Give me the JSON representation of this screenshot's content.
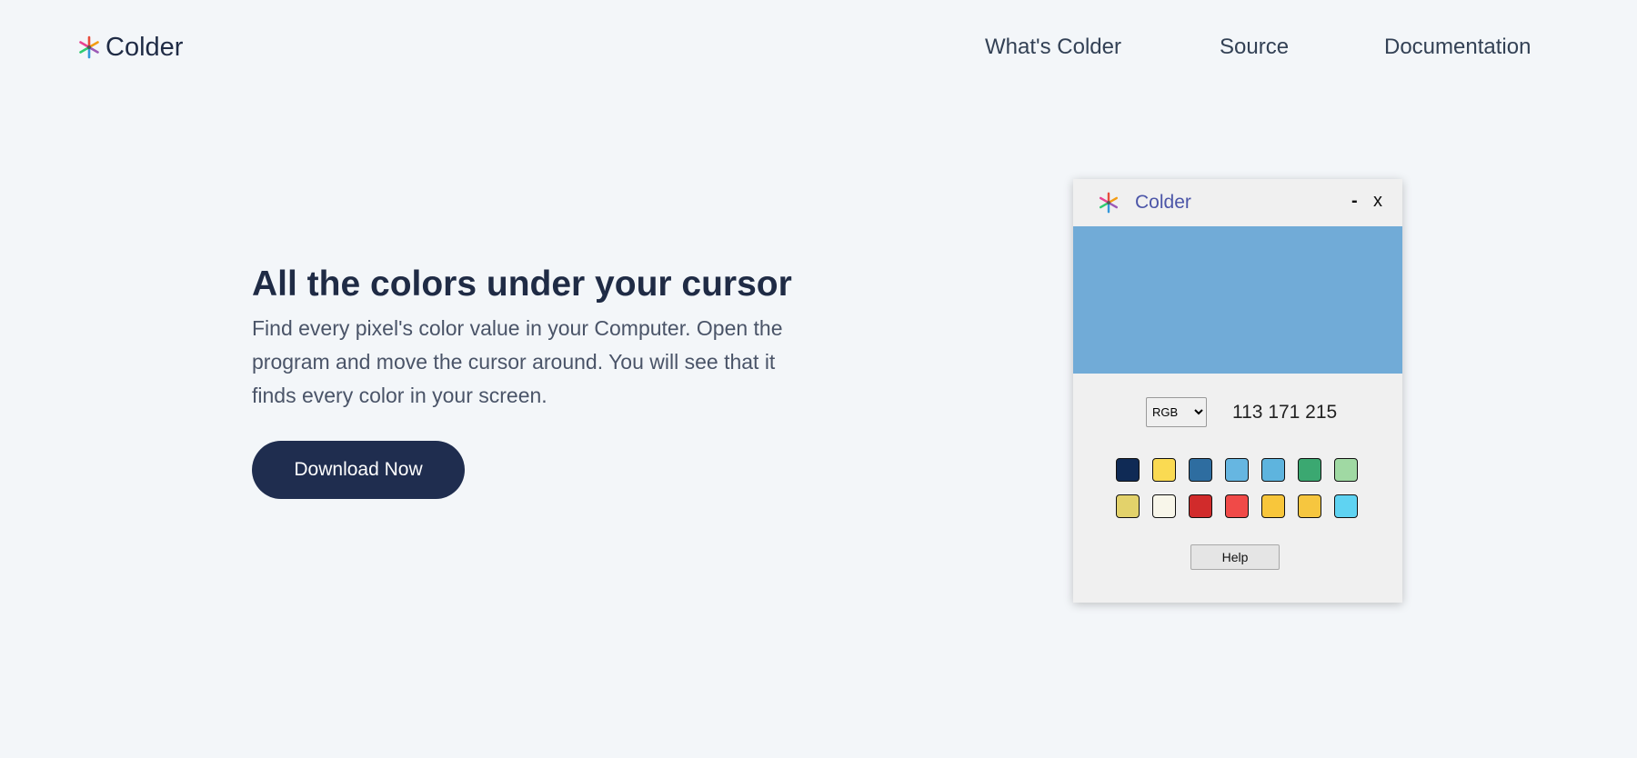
{
  "header": {
    "brand_name": "Colder",
    "logo_icon": "snowflake-icon",
    "nav": [
      "What's Colder",
      "Source",
      "Documentation"
    ]
  },
  "hero": {
    "title": "All the colors under your cursor",
    "description": "Find every pixel's color value in your Computer. Open the program and move the cursor around. You will see that it finds every color in your screen.",
    "cta_label": "Download Now"
  },
  "app_window": {
    "title": "Colder",
    "minimize_label": "-",
    "close_label": "x",
    "preview_color": "#71abd7",
    "format_options": [
      "RGB"
    ],
    "format_selected": "RGB",
    "color_value": "113 171 215",
    "swatches": [
      "#0f2a55",
      "#fada52",
      "#2e6da0",
      "#66b6e1",
      "#5eb4de",
      "#3ba871",
      "#a0d9a3",
      "#e3d26b",
      "#f8f6ea",
      "#d12b2b",
      "#f04a48",
      "#f8c63b",
      "#f6c63f",
      "#5fd3f2"
    ],
    "help_label": "Help"
  }
}
